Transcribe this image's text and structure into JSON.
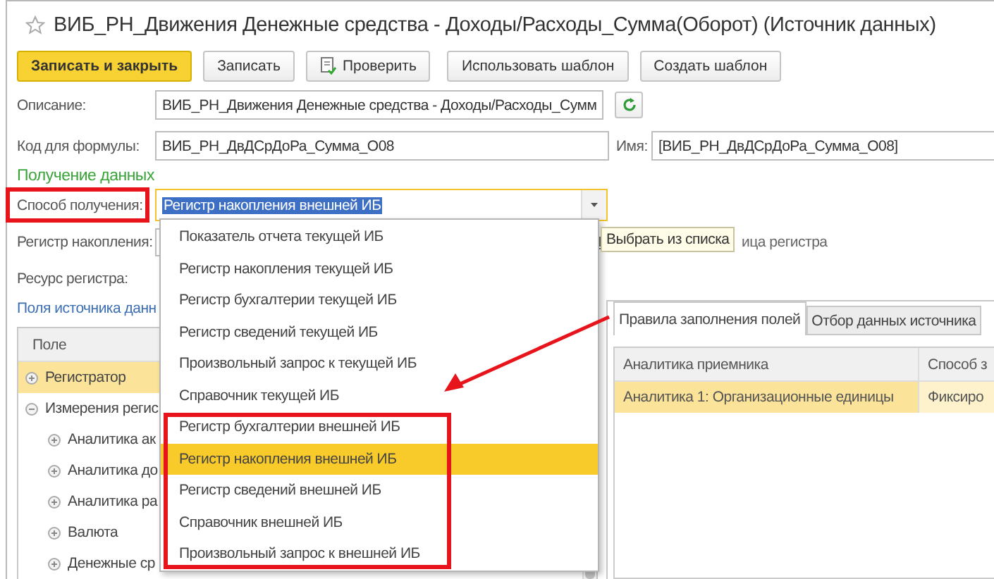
{
  "window": {
    "title": "ВИБ_РН_Движения Денежные средства - Доходы/Расходы_Сумма(Оборот) (Источник данных)",
    "favorite": false
  },
  "toolbar": [
    {
      "label": "Записать и закрыть",
      "kind": "primary"
    },
    {
      "label": "Записать",
      "kind": "plain"
    },
    {
      "label": "Проверить",
      "kind": "check"
    },
    {
      "label": "Использовать шаблон",
      "kind": "plain"
    },
    {
      "label": "Создать шаблон",
      "kind": "plain"
    }
  ],
  "description": {
    "label": "Описание:",
    "value": "ВИБ_РН_Движения Денежные средства - Доходы/Расходы_Сумм"
  },
  "formula_code": {
    "label": "Код для формулы:",
    "value": "ВИБ_РН_ДвДСрДоРа_Сумма_O08"
  },
  "name": {
    "label": "Имя:",
    "value": "[ВИБ_РН_ДвДСрДоРа_Сумма_O08]"
  },
  "section_title": "Получение данных",
  "method": {
    "label": "Способ получения:",
    "value": "Регистр накопления внешней ИБ"
  },
  "register": {
    "label": "Регистр накопления:"
  },
  "register_table_label": "ица регистра",
  "resource": {
    "label": "Ресурс регистра:"
  },
  "fields_link": "Поля источника данн",
  "fields_tree": {
    "column": "Поле",
    "rows": [
      {
        "label": "Регистратор",
        "selected": true,
        "expanded": false,
        "children": []
      },
      {
        "label": "Измерения регис",
        "selected": false,
        "expanded": true,
        "children": [
          {
            "label": "Аналитика ак",
            "selected": false,
            "expanded": false
          },
          {
            "label": "Аналитика до",
            "selected": false,
            "expanded": false
          },
          {
            "label": "Аналитика ра",
            "selected": false,
            "expanded": false
          },
          {
            "label": "Валюта",
            "selected": false,
            "expanded": false
          },
          {
            "label": "Денежные ср",
            "selected": false,
            "expanded": false
          }
        ]
      }
    ]
  },
  "right_tabs": [
    {
      "label": "Правила заполнения полей",
      "selected": true
    },
    {
      "label": "Отбор данных источника",
      "selected": false
    }
  ],
  "rules_table": {
    "columns": [
      "Аналитика приемника",
      "Способ з"
    ],
    "rows": [
      {
        "cells": [
          "Аналитика 1: Организационные единицы",
          "Фиксиро"
        ],
        "selected": true
      }
    ]
  },
  "dropdown": [
    {
      "label": "Показатель отчета текущей ИБ",
      "selected": false
    },
    {
      "label": "Регистр накопления текущей ИБ",
      "selected": false
    },
    {
      "label": "Регистр бухгалтерии текущей ИБ",
      "selected": false
    },
    {
      "label": "Регистр сведений текущей ИБ",
      "selected": false
    },
    {
      "label": "Произвольный запрос к текущей ИБ",
      "selected": false
    },
    {
      "label": "Справочник текущей ИБ",
      "selected": false
    },
    {
      "label": "Регистр бухгалтерии внешней ИБ",
      "selected": false
    },
    {
      "label": "Регистр накопления внешней ИБ",
      "selected": true
    },
    {
      "label": "Регистр сведений внешней ИБ",
      "selected": false
    },
    {
      "label": "Справочник внешней ИБ",
      "selected": false
    },
    {
      "label": "Произвольный запрос к внешней ИБ",
      "selected": false
    }
  ],
  "tooltip": "Выбрать из списка"
}
